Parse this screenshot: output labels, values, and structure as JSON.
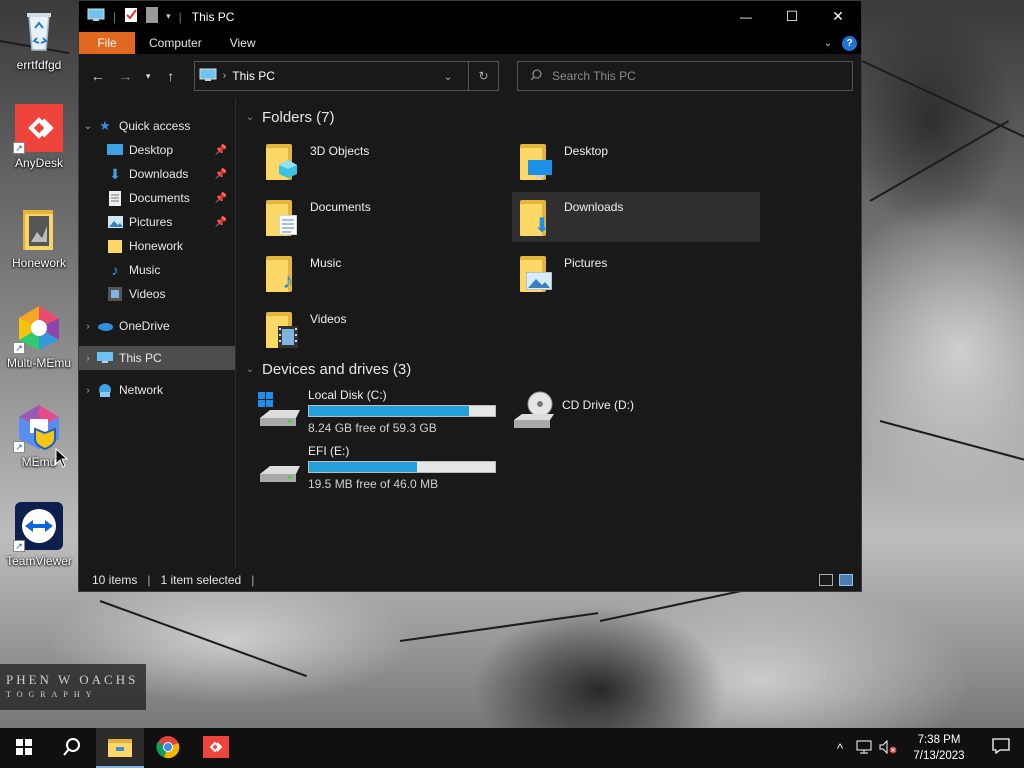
{
  "desktop": {
    "icons": [
      {
        "label": "errtfdfgd",
        "icon": "recycle-bin-icon"
      },
      {
        "label": "AnyDesk",
        "icon": "anydesk-icon"
      },
      {
        "label": "Honework",
        "icon": "folder-icon"
      },
      {
        "label": "Multi-MEmu",
        "icon": "multi-memu-icon"
      },
      {
        "label": "MEmu",
        "icon": "memu-icon"
      },
      {
        "label": "TeamViewer",
        "icon": "teamviewer-icon"
      }
    ],
    "watermark": {
      "line1": "PHEN W OACHS",
      "line2": "TOGRAPHY"
    }
  },
  "window": {
    "title": "This PC",
    "controls": {
      "minimize": "—",
      "maximize": "☐",
      "close": "✕"
    },
    "ribbon": {
      "tabs": [
        "File",
        "Computer",
        "View"
      ]
    },
    "address": {
      "location": "This PC",
      "search_placeholder": "Search This PC"
    },
    "nav": {
      "quick_access": "Quick access",
      "items": [
        {
          "label": "Desktop",
          "pinned": true
        },
        {
          "label": "Downloads",
          "pinned": true
        },
        {
          "label": "Documents",
          "pinned": true
        },
        {
          "label": "Pictures",
          "pinned": true
        },
        {
          "label": "Honework",
          "pinned": false
        },
        {
          "label": "Music",
          "pinned": false
        },
        {
          "label": "Videos",
          "pinned": false
        }
      ],
      "onedrive": "OneDrive",
      "this_pc": "This PC",
      "network": "Network"
    },
    "folders_header": "Folders (7)",
    "folders": [
      "3D Objects",
      "Desktop",
      "Documents",
      "Downloads",
      "Music",
      "Pictures",
      "Videos"
    ],
    "drives_header": "Devices and drives (3)",
    "drives": [
      {
        "name": "Local Disk (C:)",
        "free": "8.24 GB free of 59.3 GB",
        "used_fraction": 0.86
      },
      {
        "name": "CD Drive (D:)"
      },
      {
        "name": "EFI (E:)",
        "free": "19.5 MB free of 46.0 MB",
        "used_fraction": 0.58
      }
    ],
    "status": {
      "items": "10 items",
      "selected": "1 item selected"
    }
  },
  "taskbar": {
    "clock_time": "7:38 PM",
    "clock_date": "7/13/2023"
  },
  "colors": {
    "file_tab": "#e0691f",
    "drive_bar": "#26a0da",
    "window_bg": "#191919"
  }
}
